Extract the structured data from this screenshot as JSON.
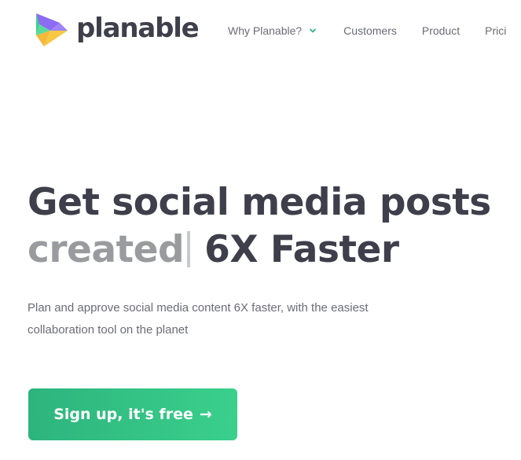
{
  "header": {
    "logo_text": "planable",
    "nav": [
      {
        "label": "Why Planable?",
        "has_dropdown": true
      },
      {
        "label": "Customers"
      },
      {
        "label": "Product"
      },
      {
        "label": "Prici"
      }
    ]
  },
  "hero": {
    "title_line1": "Get social media posts",
    "typed_word": "created",
    "title_line2_rest": "6X Faster",
    "subtitle": "Plan and approve social media content 6X faster, with the easiest collaboration tool on the planet",
    "cta_label": "Sign up, it's free",
    "cta_arrow": "→"
  },
  "colors": {
    "accent_green": "#2db47d",
    "accent_green_light": "#3ad08c",
    "heading": "#3f3f4c",
    "muted_heading": "#9a9b9e",
    "body_text": "#6b6c77",
    "logo_purple": "#8b6cf2",
    "logo_yellow": "#f7c843",
    "logo_green": "#39c98a"
  },
  "icons": {
    "logo": "planable-logo-mark",
    "dropdown": "chevron-down-icon",
    "cta": "arrow-right-icon"
  }
}
